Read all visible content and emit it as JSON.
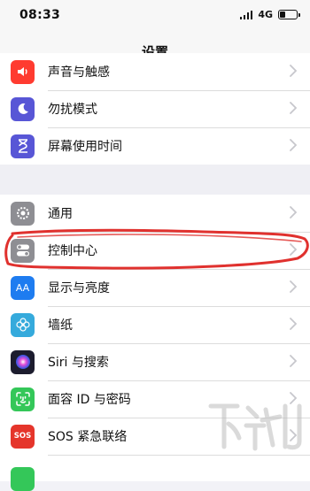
{
  "status": {
    "time": "08:33",
    "network": "4G",
    "signal_bars": 4,
    "battery_level": 0.35
  },
  "nav": {
    "title": "设置"
  },
  "group1": [
    {
      "label": "声音与触感",
      "icon": "speaker-icon",
      "color": "#ff3b30"
    },
    {
      "label": "勿扰模式",
      "icon": "moon-icon",
      "color": "#5856d6"
    },
    {
      "label": "屏幕使用时间",
      "icon": "hourglass-icon",
      "color": "#5856d6"
    }
  ],
  "group2": [
    {
      "label": "通用",
      "icon": "gear-icon",
      "color": "#8e8e93"
    },
    {
      "label": "控制中心",
      "icon": "toggle-icon",
      "color": "#8e8e93"
    },
    {
      "label": "显示与亮度",
      "icon": "aa-icon",
      "color": "#1e7cf0",
      "icon_text": "AA"
    },
    {
      "label": "墙纸",
      "icon": "flower-icon",
      "color": "#35aadc"
    },
    {
      "label": "Siri 与搜索",
      "icon": "siri-icon",
      "color": "#1c1c2e"
    },
    {
      "label": "面容 ID 与密码",
      "icon": "faceid-icon",
      "color": "#34c759"
    },
    {
      "label": "SOS 紧急联络",
      "icon": "sos-icon",
      "color": "#e5352b",
      "icon_text": "SOS"
    }
  ],
  "colors": {
    "annotation": "#e0312e",
    "chevron": "#c7c7cc"
  }
}
